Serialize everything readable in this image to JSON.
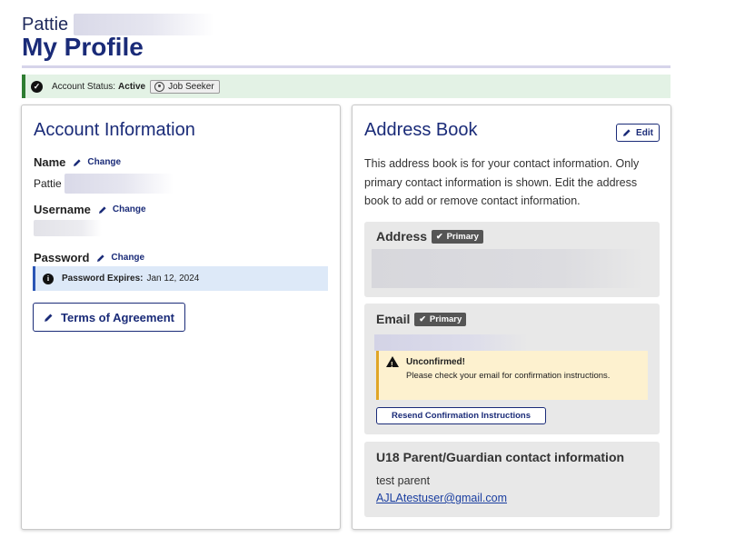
{
  "header": {
    "greeting_name": "Pattie",
    "title": "My Profile"
  },
  "status": {
    "label": "Account Status:",
    "value": "Active",
    "role": "Job Seeker",
    "accent_color": "#2e7d32"
  },
  "account_info": {
    "heading": "Account Information",
    "name_label": "Name",
    "name_change": "Change",
    "name_value": "Pattie",
    "username_label": "Username",
    "username_change": "Change",
    "password_label": "Password",
    "password_change": "Change",
    "password_expires_label": "Password Expires:",
    "password_expires_value": "Jan 12, 2024",
    "terms_button": "Terms of Agreement"
  },
  "address_book": {
    "heading": "Address Book",
    "edit_label": "Edit",
    "description": "This address book is for your contact information. Only primary contact information is shown. Edit the address book to add or remove contact information.",
    "address_heading": "Address",
    "email_heading": "Email",
    "primary_badge": "Primary",
    "unconfirmed_title": "Unconfirmed!",
    "unconfirmed_text": "Please check your email for confirmation instructions.",
    "resend_button": "Resend Confirmation Instructions",
    "guardian_heading": "U18 Parent/Guardian contact information",
    "guardian_name": "test parent",
    "guardian_email": "AJLAtestuser@gmail.com"
  },
  "colors": {
    "brand": "#1a2b78",
    "info_border": "#2a55b5",
    "warning_border": "#e0a526"
  }
}
